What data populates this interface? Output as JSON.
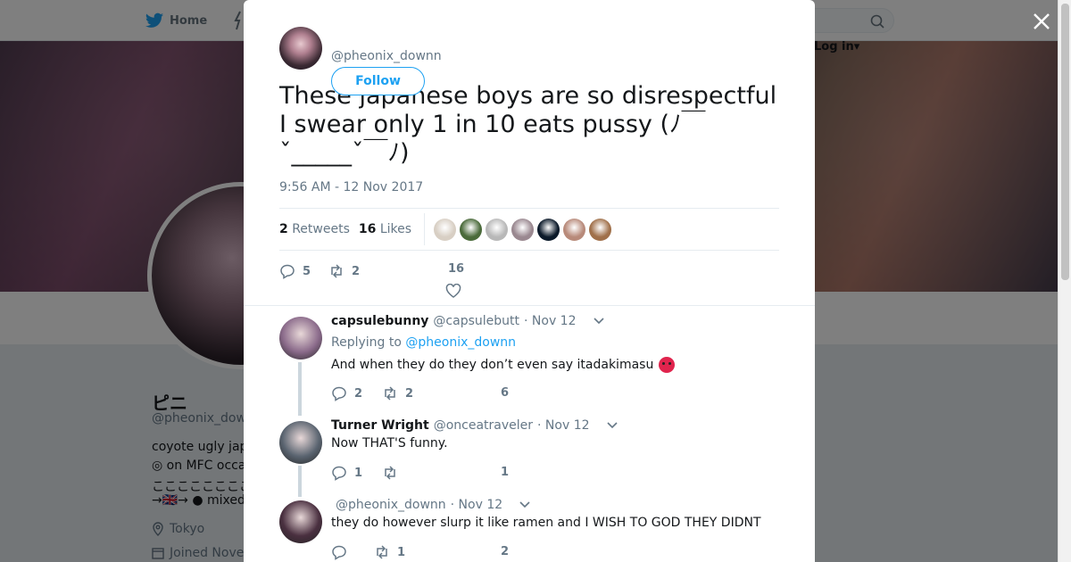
{
  "nav": {
    "home_label": "Home",
    "login_label": "Log in"
  },
  "profile": {
    "name": "ピニ",
    "handle": "@pheonix_downn",
    "bio_lines": [
      "coyote ugly jap",
      "◎ on MFC occa",
      "ここここここここここここここ",
      "→🇬🇧→ ● mixed"
    ],
    "location": "Tokyo",
    "joined": "Joined Nove"
  },
  "tweet": {
    "handle": "@pheonix_downn",
    "follow_label": "Follow",
    "text": "These japanese boys are so disrespectful I swear only 1 in 10 eats pussy (ﾉ￣ˇ_____ˇ￣ﾉ)",
    "timestamp": "9:56 AM - 12 Nov 2017",
    "retweets_count": "2",
    "retweets_label": "Retweets",
    "likes_count": "16",
    "likes_label": "Likes",
    "reply_count": "5",
    "retweet_count": "2",
    "like_count": "16",
    "likers": [
      {
        "color": "#d8cfc4"
      },
      {
        "color": "#4a6a3a"
      },
      {
        "color": "#b8b8b8"
      },
      {
        "color": "#9a8890"
      },
      {
        "color": "#0c1a2a"
      },
      {
        "color": "#b88a7a"
      },
      {
        "color": "#a0704a"
      }
    ]
  },
  "replies": [
    {
      "name": "capsulebunny",
      "handle": "@capsulebutt",
      "date": "· Nov 12",
      "replying_prefix": "Replying to",
      "replying_to": "@pheonix_downn",
      "text": "And when they do they don’t even say itadakimasu",
      "reply_count": "2",
      "retweet_count": "2",
      "like_count": "6",
      "avatar_color": "#8a6a8a"
    },
    {
      "name": "Turner Wright",
      "handle": "@onceatraveler",
      "date": "· Nov 12",
      "text": "Now THAT'S funny.",
      "reply_count": "1",
      "retweet_count": "",
      "like_count": "1",
      "avatar_color": "#5a6470"
    },
    {
      "name": "",
      "handle": "@pheonix_downn",
      "date": "· Nov 12",
      "text": "they do however slurp it like ramen and I WISH TO GOD THEY DIDNT",
      "reply_count": "",
      "retweet_count": "1",
      "like_count": "2",
      "avatar_color": "#4a3040"
    }
  ],
  "colors": {
    "accent": "#1da1f2",
    "muted": "#657786",
    "text": "#14171a"
  }
}
